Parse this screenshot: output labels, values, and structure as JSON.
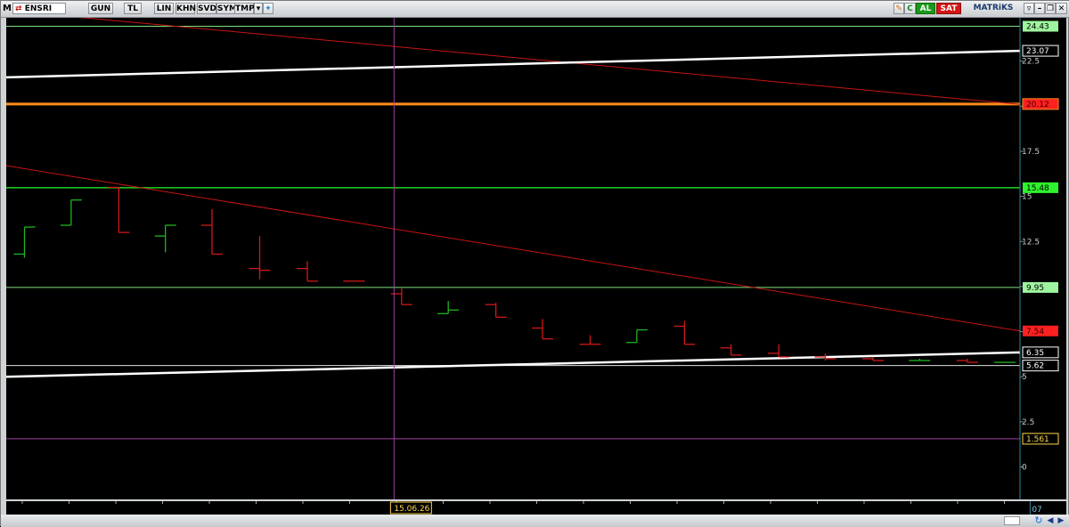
{
  "toolbar": {
    "logo_letter": "M",
    "symbol": "ENSRI",
    "period": "GUN",
    "currency": "TL",
    "scale_lin": "LIN",
    "khn": "KHN",
    "svd": "SVD",
    "sym": "SYM",
    "tmp": "TMP",
    "buy": "AL",
    "sell": "SAT",
    "brand": "MATRiKS",
    "c_button": "C"
  },
  "colors": {
    "up": "#1fb51f",
    "down": "#d01818",
    "red_trend": "#c81414",
    "white_trend": "#ffffff",
    "orange": "#ff8c1a",
    "green_line": "#1fd21f",
    "light_green_line": "#7fe07f",
    "purple": "#a040a0",
    "white_hline": "#e0e0e0"
  },
  "chart_data": {
    "type": "line",
    "symbol": "ENSRI",
    "ylim": [
      -1.8,
      24.9
    ],
    "yticks": [
      0,
      2.5,
      5,
      7.5,
      10,
      12.5,
      15,
      17.5,
      20,
      22.5
    ],
    "horizontal_levels": [
      {
        "value": 24.43,
        "label": "24.43",
        "color": "light_green"
      },
      {
        "value": 20.12,
        "label": "20.12",
        "color": "orange"
      },
      {
        "value": 15.48,
        "label": "15.48",
        "color": "green"
      },
      {
        "value": 9.95,
        "label": "9.95",
        "color": "light_green"
      },
      {
        "value": 5.62,
        "label": "5.62",
        "color": "white"
      },
      {
        "value": 1.561,
        "label": "1.561",
        "color": "purple"
      }
    ],
    "right_labels": [
      {
        "value": 23.07,
        "label": "23.07",
        "style": "white"
      },
      {
        "value": 7.54,
        "label": "7.54",
        "style": "red"
      },
      {
        "value": 6.35,
        "label": "6.35",
        "style": "white"
      }
    ],
    "trendlines": [
      {
        "name": "red-upper",
        "color": "red",
        "from": [
          0,
          25.3
        ],
        "to": [
          1,
          20.1
        ]
      },
      {
        "name": "red-lower",
        "color": "red",
        "from": [
          0,
          16.7
        ],
        "to": [
          1,
          7.54
        ]
      },
      {
        "name": "white-upper",
        "color": "white",
        "from": [
          0,
          21.6
        ],
        "to": [
          1,
          23.07
        ]
      },
      {
        "name": "white-lower",
        "color": "white",
        "from": [
          0,
          5.0
        ],
        "to": [
          1,
          6.35
        ]
      }
    ],
    "bars": [
      {
        "x": 0.018,
        "open": 11.8,
        "close": 13.3,
        "high": 13.3,
        "low": 11.6,
        "dir": "up"
      },
      {
        "x": 0.064,
        "open": 13.4,
        "close": 14.8,
        "high": 14.8,
        "low": 13.4,
        "dir": "up"
      },
      {
        "x": 0.111,
        "open": 15.5,
        "close": 13.0,
        "high": 15.5,
        "low": 13.0,
        "dir": "down"
      },
      {
        "x": 0.157,
        "open": 12.8,
        "close": 13.4,
        "high": 13.4,
        "low": 11.9,
        "dir": "up"
      },
      {
        "x": 0.203,
        "open": 13.4,
        "close": 11.8,
        "high": 14.3,
        "low": 11.8,
        "dir": "down"
      },
      {
        "x": 0.25,
        "open": 11.0,
        "close": 10.9,
        "high": 12.8,
        "low": 10.4,
        "dir": "down"
      },
      {
        "x": 0.297,
        "open": 11.0,
        "close": 10.3,
        "high": 11.4,
        "low": 10.3,
        "dir": "down"
      },
      {
        "x": 0.343,
        "open": 10.3,
        "close": 10.3,
        "high": 10.3,
        "low": 10.3,
        "dir": "down"
      },
      {
        "x": 0.39,
        "open": 9.6,
        "close": 9.0,
        "high": 9.9,
        "low": 9.0,
        "dir": "down"
      },
      {
        "x": 0.436,
        "open": 8.5,
        "close": 8.7,
        "high": 9.2,
        "low": 8.5,
        "dir": "up"
      },
      {
        "x": 0.483,
        "open": 9.0,
        "close": 8.3,
        "high": 9.1,
        "low": 8.3,
        "dir": "down"
      },
      {
        "x": 0.529,
        "open": 7.7,
        "close": 7.1,
        "high": 8.2,
        "low": 7.1,
        "dir": "down"
      },
      {
        "x": 0.576,
        "open": 6.8,
        "close": 6.8,
        "high": 7.3,
        "low": 6.8,
        "dir": "down"
      },
      {
        "x": 0.622,
        "open": 6.9,
        "close": 7.6,
        "high": 7.6,
        "low": 6.9,
        "dir": "up"
      },
      {
        "x": 0.669,
        "open": 7.8,
        "close": 6.8,
        "high": 8.1,
        "low": 6.8,
        "dir": "down"
      },
      {
        "x": 0.715,
        "open": 6.6,
        "close": 6.2,
        "high": 6.8,
        "low": 6.2,
        "dir": "down"
      },
      {
        "x": 0.762,
        "open": 6.3,
        "close": 6.1,
        "high": 6.8,
        "low": 6.1,
        "dir": "down"
      },
      {
        "x": 0.808,
        "open": 6.1,
        "close": 6.0,
        "high": 6.3,
        "low": 5.9,
        "dir": "down"
      },
      {
        "x": 0.855,
        "open": 6.0,
        "close": 5.9,
        "high": 6.1,
        "low": 5.9,
        "dir": "down"
      },
      {
        "x": 0.901,
        "open": 5.9,
        "close": 5.9,
        "high": 6.0,
        "low": 5.9,
        "dir": "up"
      },
      {
        "x": 0.948,
        "open": 5.9,
        "close": 5.8,
        "high": 6.0,
        "low": 5.8,
        "dir": "down"
      },
      {
        "x": 0.985,
        "open": 5.8,
        "close": 5.8,
        "high": 5.8,
        "low": 5.8,
        "dir": "up"
      }
    ],
    "cursor": {
      "x": 0.343,
      "date_label": "15.06.26",
      "value_label": "1.561"
    },
    "x_labels": [
      {
        "x": 0.901,
        "label": "07"
      }
    ]
  }
}
